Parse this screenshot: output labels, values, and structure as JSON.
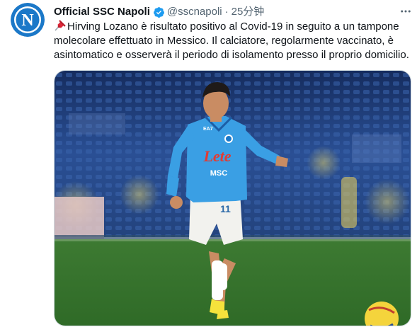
{
  "tweet": {
    "author": {
      "display_name": "Official SSC Napoli",
      "handle": "@sscnapoli",
      "verified": true,
      "avatar_icon": "napoli-crest-icon",
      "avatar_letter": "N"
    },
    "separator": "·",
    "time": "25分钟",
    "text": "Hirving Lozano è risultato positivo al Covid-19 in seguito a un tampone molecolare effettuato in Messico. Il calciatore, regolarmente vaccinato, è asintomatico e osserverà il periodo di isolamento presso il proprio domicilio.",
    "leading_emoji": "pushpin-icon",
    "media": {
      "kit_sponsor": "Lete",
      "kit_sponsor_2": "MSC",
      "kit_brand": "EA7",
      "shorts_number": "11"
    }
  },
  "colors": {
    "napoli_blue": "#3a9fe4",
    "crest_blue": "#1b78c8",
    "verified": "#1d9bf0",
    "sponsor_red": "#e23b32",
    "pitch_green": "#3f7a33",
    "stand_blue": "#1f3c7a",
    "text_secondary": "#536471"
  }
}
